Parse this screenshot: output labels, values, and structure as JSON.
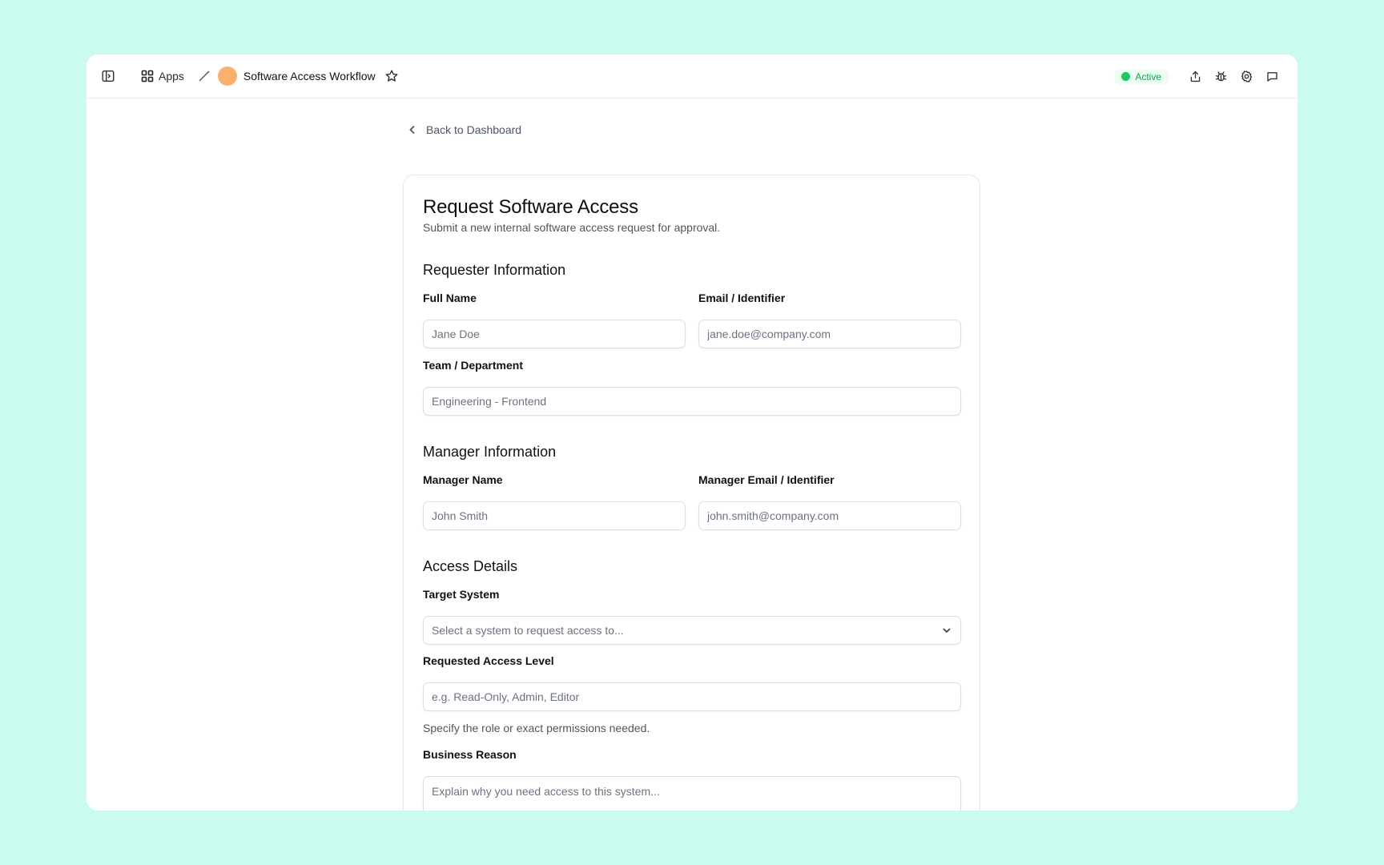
{
  "topbar": {
    "apps_label": "Apps",
    "workflow_title": "Software Access Workflow",
    "status_label": "Active",
    "avatar_color": "#fbb070",
    "icons": [
      "sidebar-toggle-icon",
      "grid-icon",
      "star-icon",
      "share-icon",
      "bug-icon",
      "gear-icon",
      "chat-icon"
    ]
  },
  "nav": {
    "back_label": "Back to Dashboard"
  },
  "form": {
    "title": "Request Software Access",
    "subtitle": "Submit a new internal software access request for approval.",
    "requester": {
      "heading": "Requester Information",
      "full_name_label": "Full Name",
      "full_name_placeholder": "Jane Doe",
      "email_label": "Email / Identifier",
      "email_placeholder": "jane.doe@company.com",
      "team_label": "Team / Department",
      "team_placeholder": "Engineering - Frontend"
    },
    "manager": {
      "heading": "Manager Information",
      "name_label": "Manager Name",
      "name_placeholder": "John Smith",
      "email_label": "Manager Email / Identifier",
      "email_placeholder": "john.smith@company.com"
    },
    "access": {
      "heading": "Access Details",
      "system_label": "Target System",
      "system_placeholder": "Select a system to request access to...",
      "level_label": "Requested Access Level",
      "level_placeholder": "e.g. Read-Only, Admin, Editor",
      "level_helper": "Specify the role or exact permissions needed.",
      "reason_label": "Business Reason",
      "reason_placeholder": "Explain why you need access to this system..."
    }
  }
}
